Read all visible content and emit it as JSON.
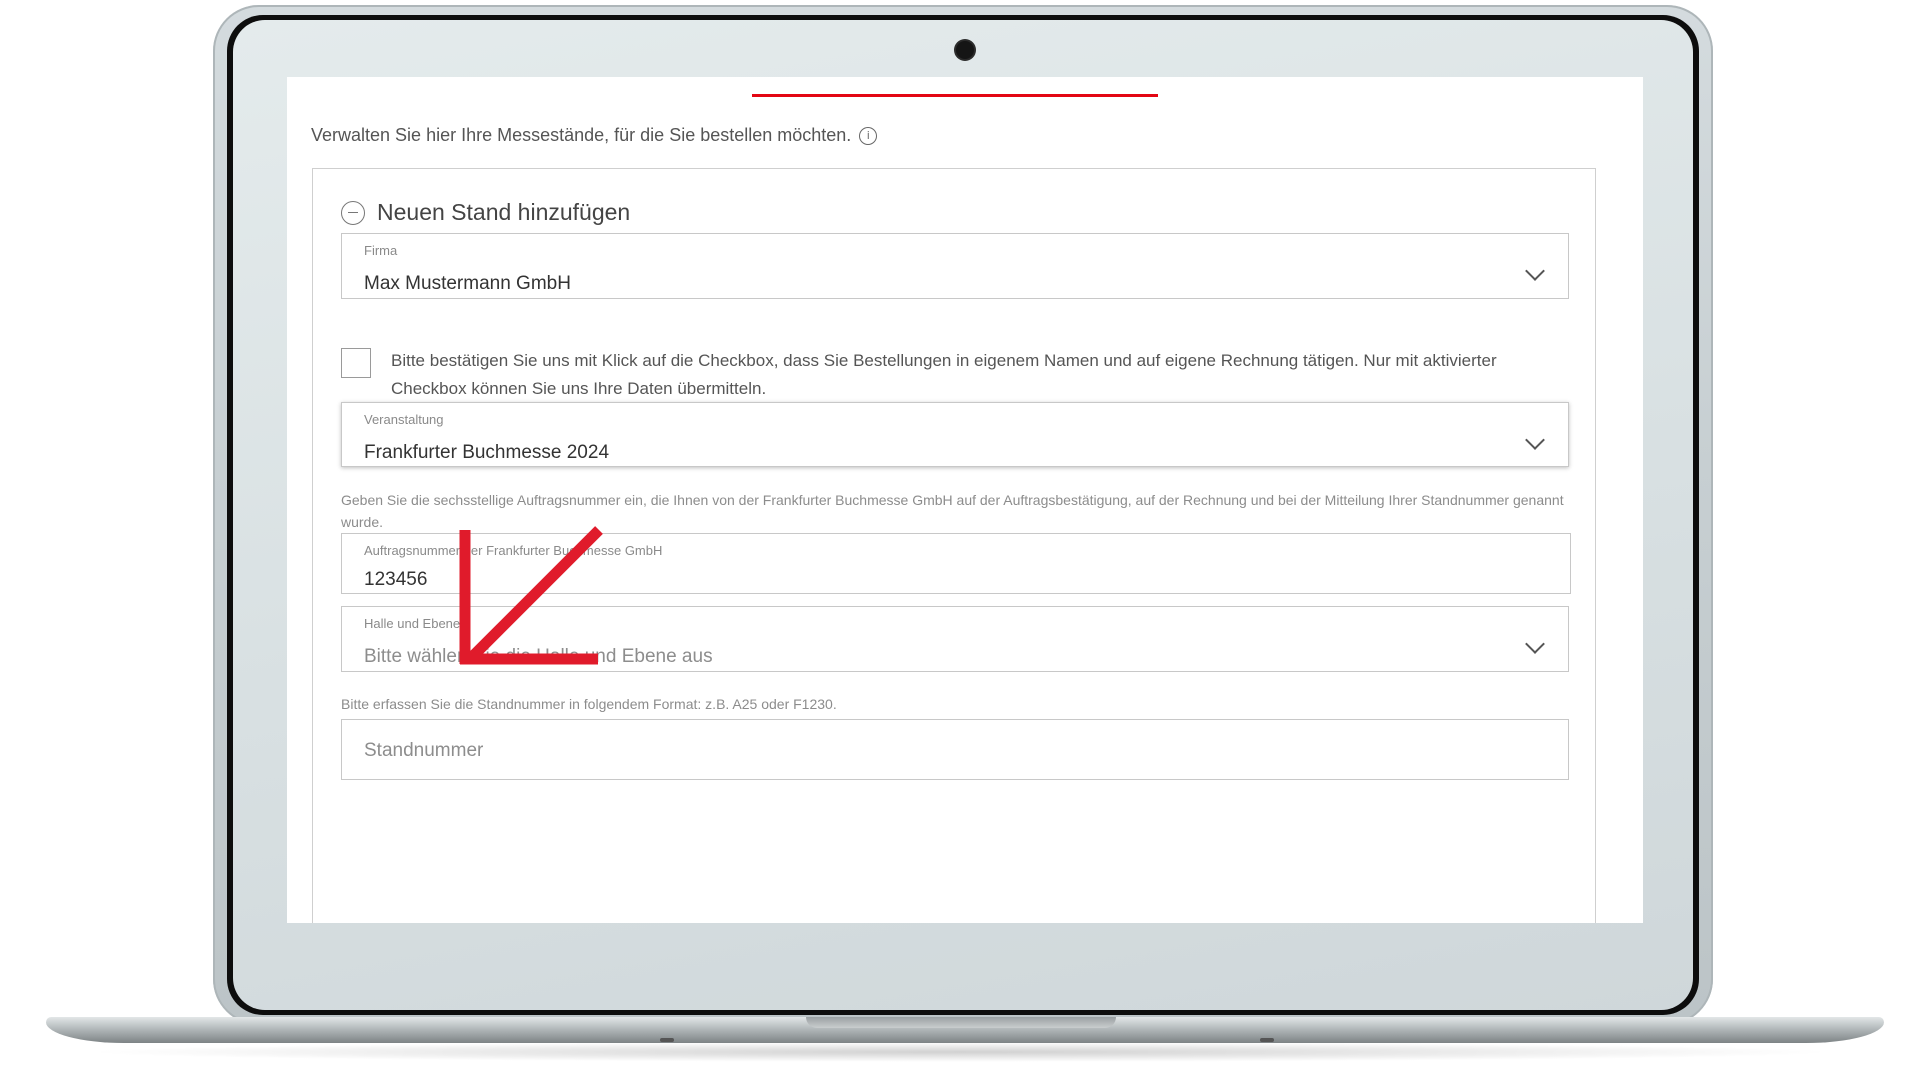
{
  "intro": {
    "text": "Verwalten Sie hier Ihre Messestände, für die Sie bestellen möchten.",
    "info_icon": "info-icon"
  },
  "section": {
    "title": "Neuen Stand hinzufügen",
    "icon": "minus-circle-icon"
  },
  "firma": {
    "label": "Firma",
    "value": "Max Mustermann GmbH"
  },
  "confirmation": {
    "checked": false,
    "text": "Bitte bestätigen Sie uns mit Klick auf die Checkbox, dass Sie Bestellungen in eigenem Namen und auf eigene Rechnung tätigen. Nur mit aktivierter Checkbox können Sie uns Ihre Daten übermitteln."
  },
  "veranstaltung": {
    "label": "Veranstaltung",
    "value": "Frankfurter Buchmesse 2024"
  },
  "auftrag": {
    "help": "Geben Sie die sechsstellige Auftragsnummer ein, die Ihnen von der Frankfurter Buchmesse GmbH auf der Auftragsbestätigung, auf der Rechnung und bei der Mitteilung Ihrer Standnummer genannt wurde.",
    "label": "Auftragsnummer der Frankfurter Buchmesse GmbH",
    "value": "123456"
  },
  "halle": {
    "label": "Halle und Ebene",
    "placeholder": "Bitte wählen Sie die Halle und Ebene aus"
  },
  "standnummer": {
    "help": "Bitte erfassen Sie die Standnummer in folgendem Format: z.B. A25 oder F1230.",
    "placeholder": "Standnummer"
  },
  "colors": {
    "accent": "#e30613",
    "annotation_arrow": "#e01b2b"
  }
}
